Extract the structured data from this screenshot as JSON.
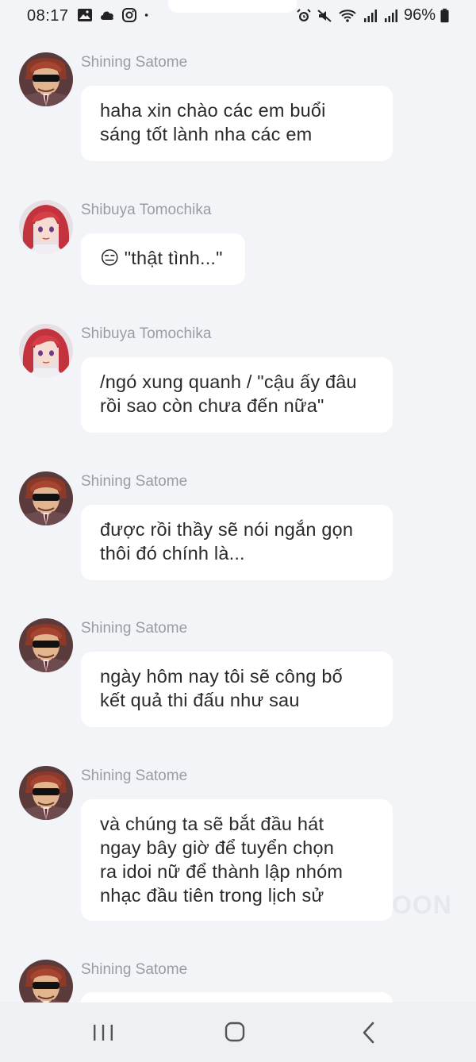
{
  "status_bar": {
    "time": "08:17",
    "battery": "96%",
    "left_icons": [
      "gallery-icon",
      "cloud-icon",
      "instagram-icon",
      "dot-icon"
    ],
    "right_icons": [
      "alarm-icon",
      "mute-icon",
      "wifi-icon",
      "signal-icon",
      "signal-icon",
      "battery-icon"
    ]
  },
  "messages": [
    {
      "sender": "Shining Satome",
      "avatar": "satome",
      "lines": [
        "haha xin chào các em buổi",
        "sáng tốt lành nha các em"
      ]
    },
    {
      "sender": "Shibuya Tomochika",
      "avatar": "tomochika",
      "emoji": "😑",
      "lines": [
        "\"thật tình...\""
      ]
    },
    {
      "sender": "Shibuya Tomochika",
      "avatar": "tomochika",
      "lines": [
        "/ngó xung quanh / \"cậu ấy đâu",
        "rồi sao còn chưa đến nữa\""
      ]
    },
    {
      "sender": "Shining Satome",
      "avatar": "satome",
      "lines": [
        "được rồi thầy sẽ nói ngắn gọn",
        "thôi đó chính là..."
      ]
    },
    {
      "sender": "Shining Satome",
      "avatar": "satome",
      "lines": [
        "ngày hôm nay tôi sẽ công bố",
        "kết quả thi đấu như sau"
      ]
    },
    {
      "sender": "Shining Satome",
      "avatar": "satome",
      "lines": [
        "và chúng ta sẽ bắt đầu hát",
        "ngay bây giờ để tuyển chọn",
        "ra idoi nữ để thành lập nhóm",
        "nhạc đầu tiên trong lịch sử"
      ]
    },
    {
      "sender": "Shining Satome",
      "avatar": "satome",
      "lines": []
    }
  ],
  "watermark": "OON",
  "nav_bar": {
    "buttons": [
      "recent-apps",
      "home",
      "back"
    ]
  }
}
